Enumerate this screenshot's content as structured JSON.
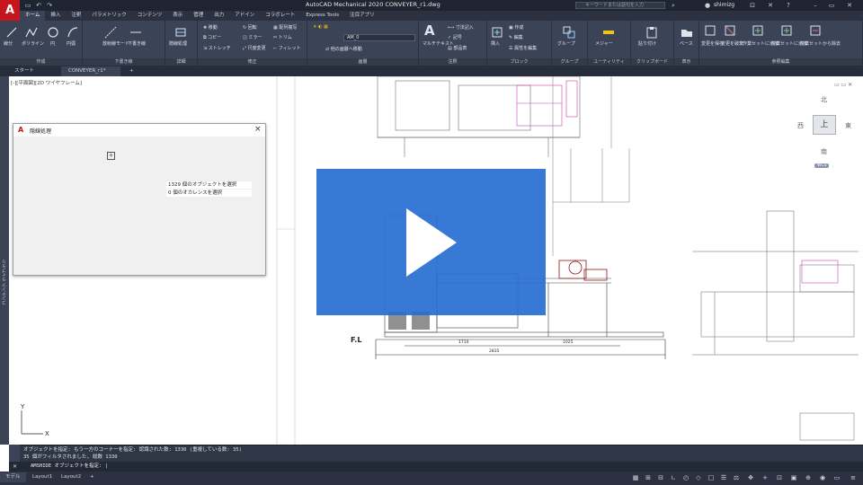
{
  "window": {
    "title": "AutoCAD Mechanical 2020    CONVEYER_r1.dwg",
    "search_placeholder": "キーワードまたは語句を入力",
    "user": "shimizg",
    "app_logo": "A"
  },
  "ribbon_tabs": [
    "ホーム",
    "挿入",
    "注釈",
    "パラメトリック",
    "コンテンツ",
    "表示",
    "管理",
    "出力",
    "アドイン",
    "コラボレート",
    "Express Tools",
    "注目アプリ"
  ],
  "ribbon_active_tab": "ホーム",
  "ribbon_panels": [
    {
      "label": "作成",
      "buttons": [
        "線分",
        "ポリライン",
        "円",
        "円弧"
      ]
    },
    {
      "label": "下書き線",
      "buttons": [
        "放射線モード",
        "下書き線"
      ]
    },
    {
      "label": "詳細",
      "buttons": [
        "隠線処理"
      ]
    },
    {
      "label": "修正",
      "buttons": [
        "移動",
        "回転",
        "配列複写",
        "コピー",
        "ミラー",
        "トリム",
        "ストレッチ",
        "尺度変更",
        "フィレット"
      ]
    },
    {
      "label": "画層",
      "buttons": [
        "AM_0",
        "他の画層へ移動"
      ]
    },
    {
      "label": "注釈",
      "buttons": [
        "マルチテキスト",
        "寸法記入",
        "記号",
        "部品表"
      ]
    },
    {
      "label": "ブロック",
      "buttons": [
        "挿入",
        "作成",
        "編集",
        "属性を編集"
      ]
    },
    {
      "label": "グループ",
      "buttons": [
        "グループ"
      ]
    },
    {
      "label": "ユーティリティ",
      "buttons": [
        "メジャー"
      ]
    },
    {
      "label": "クリップボード",
      "buttons": [
        "貼り付け"
      ]
    },
    {
      "label": "表示",
      "buttons": [
        "ベース"
      ]
    },
    {
      "label": "参照編集",
      "buttons": [
        "変更を保存",
        "変更を破棄",
        "作業セットに追加",
        "作業セットに追加",
        "作業セットから除去"
      ]
    }
  ],
  "file_tabs": [
    "スタート",
    "CONVEYER_r1*",
    "+"
  ],
  "viewport_label": "[-][平面図][2D ワイヤフレーム]",
  "left_palette_label": "コンテンツ ライブラリ",
  "dialog": {
    "title": "隠線処理",
    "rows": [
      "1329 個のオブジェクトを選択",
      "0 個のオカレンスを選択"
    ]
  },
  "viewcube": {
    "north": "北",
    "south": "南",
    "east": "東",
    "west": "西",
    "top": "上",
    "wcs": "WCS"
  },
  "drawing_labels": {
    "floor_level": "F.L",
    "dim_total": "2835",
    "dim_a": "1710",
    "dim_b": "1025"
  },
  "command": {
    "history": [
      "オブジェクトを指定: もう一方のコーナーを指定: 認識された数: 1330 (重複している数: 35)",
      "35 個がフィルタされました, 総数 1330"
    ],
    "prompt": "AMSHIDE オブジェクトを指定:"
  },
  "status_tabs": [
    "モデル",
    "Layout1",
    "Layout2",
    "+"
  ],
  "colors": {
    "accent": "#c4161c",
    "ribbon": "#3b4356",
    "overlay": "#2a6ed2"
  }
}
